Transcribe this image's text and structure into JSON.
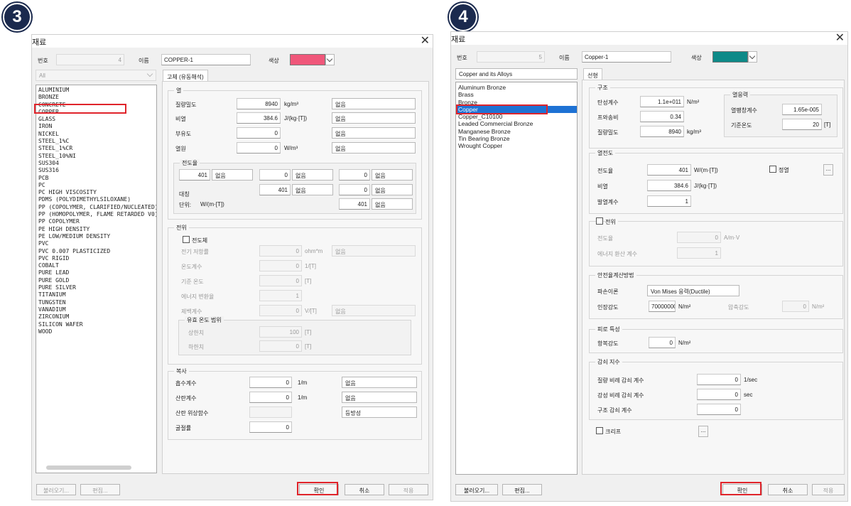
{
  "badges": {
    "left": "3",
    "right": "4"
  },
  "left": {
    "title": "재료",
    "num_label": "번호",
    "num_value": "4",
    "name_label": "이름",
    "name_value": "COPPER-1",
    "color_label": "색상",
    "color_hex": "#f0577a",
    "library": "All",
    "tab": "고체 (유동해석)",
    "materials": [
      "ALUMINIUM",
      "BRONZE",
      "CONCRETE",
      "COPPER",
      "GLASS",
      "IRON",
      "NICKEL",
      "STEEL_1%C",
      "STEEL_1%CR",
      "STEEL_10%NI",
      "SUS304",
      "SUS316",
      "PCB",
      "PC",
      "PC HIGH VISCOSITY",
      "PDMS (POLYDIMETHYLSILOXANE)",
      "PP (COPOLYMER, CLARIFIED/NUCLEATED)",
      "PP (HOMOPOLYMER, FLAME RETARDED V0)",
      "PP COPOLYMER",
      "PE HIGH DENSITY",
      "PE LOW/MEDIUM DENSITY",
      "PVC",
      "PVC 0.007 PLASTICIZED",
      "PVC RIGID",
      "COBALT",
      "PURE LEAD",
      "PURE GOLD",
      "PURE SILVER",
      "TITANIUM",
      "TUNGSTEN",
      "VANADIUM",
      "ZIRCONIUM",
      "SILICON WAFER",
      "WOOD"
    ],
    "heat": {
      "title": "열",
      "density": {
        "label": "질량밀도",
        "value": "8940",
        "unit": "kg/m³",
        "opt": "없음"
      },
      "specific_heat": {
        "label": "비열",
        "value": "384.6",
        "unit": "J/(kg·[T])",
        "opt": "없음"
      },
      "buoyancy": {
        "label": "부유도",
        "value": "0",
        "unit": "",
        "opt": "없음"
      },
      "heat_source": {
        "label": "열원",
        "value": "0",
        "unit": "W/m³",
        "opt": "없음"
      },
      "cond": {
        "title": "전도율",
        "r1": [
          {
            "v": "401",
            "o": "없음"
          },
          {
            "v": "0",
            "o": "없음"
          },
          {
            "v": "0",
            "o": "없음"
          }
        ],
        "r2": [
          {
            "v": "401",
            "o": "없음"
          },
          {
            "v": "0",
            "o": "없음"
          }
        ],
        "sym_label": "대칭",
        "unit_label": "단위:",
        "unit": "W/(m·[T])",
        "r3": {
          "v": "401",
          "o": "없음"
        }
      }
    },
    "elec": {
      "title": "전위",
      "conductor": "전도체",
      "resistivity": {
        "label": "전기 저항률",
        "value": "0",
        "unit": "ohm*m",
        "opt": "없음"
      },
      "temp_coef": {
        "label": "온도계수",
        "value": "0",
        "unit": "1/[T]"
      },
      "ref_temp": {
        "label": "기준 온도",
        "value": "0",
        "unit": "[T]"
      },
      "energy": {
        "label": "에너지 변환율",
        "value": "1"
      },
      "seebeck": {
        "label": "제백계수",
        "value": "0",
        "unit": "V/[T]",
        "opt": "없음"
      },
      "range": {
        "title": "유효 온도 범위",
        "upper_label": "상한치",
        "upper": "100",
        "lower_label": "하한치",
        "lower": "0",
        "unit": "[T]"
      }
    },
    "rad": {
      "title": "복사",
      "absorb": {
        "label": "흡수계수",
        "value": "0",
        "unit": "1/m",
        "opt": "없음"
      },
      "scatter": {
        "label": "산란계수",
        "value": "0",
        "unit": "1/m",
        "opt": "없음"
      },
      "phase": {
        "label": "산란 위상함수",
        "opt": "등방성"
      },
      "refract": {
        "label": "굴절률",
        "value": "0"
      }
    },
    "buttons": {
      "load": "불러오기...",
      "edit": "편집...",
      "ok": "확인",
      "cancel": "취소",
      "apply": "적용"
    }
  },
  "right": {
    "title": "재료",
    "num_label": "번호",
    "num_value": "5",
    "name_label": "이름",
    "name_value": "Copper-1",
    "color_label": "색상",
    "color_hex": "#0e8a88",
    "library": "Copper and its Alloys",
    "tab": "선형",
    "materials": [
      "Aluminum Bronze",
      "Brass",
      "Bronze",
      "Copper",
      "Copper_C10100",
      "Leaded Commercial Bronze",
      "Manganese Bronze",
      "Tin Bearing Bronze",
      "Wrought Copper"
    ],
    "struct": {
      "title": "구조",
      "elastic": {
        "label": "탄성계수",
        "value": "1.1e+011",
        "unit": "N/m²"
      },
      "poisson": {
        "label": "프와송비",
        "value": "0.34"
      },
      "density": {
        "label": "질량밀도",
        "value": "8940",
        "unit": "kg/m³"
      },
      "thermal": {
        "title": "열응력",
        "exp_label": "열팽창계수",
        "exp": "1.65e-005",
        "ref_label": "기준온도",
        "ref": "20",
        "ref_unit": "[T]"
      }
    },
    "heat": {
      "title": "열전도",
      "cond": {
        "label": "전도율",
        "value": "401",
        "unit": "W/(m·[T])"
      },
      "spec": {
        "label": "비열",
        "value": "384.6",
        "unit": "J/(kg·[T])"
      },
      "emis": {
        "label": "발열계수",
        "value": "1"
      },
      "dynamic": "정열",
      "more": "..."
    },
    "elec": {
      "title": "전위",
      "cond": {
        "label": "전도율",
        "value": "0",
        "unit": "A/m·V"
      },
      "energy": {
        "label": "에너지 환산 계수",
        "value": "1"
      }
    },
    "safety": {
      "title": "안전율계산방법",
      "theory_label": "파손이론",
      "theory": "Von Mises 응력(Ductile)",
      "tensile_label": "인장강도",
      "tensile": "70000000",
      "tensile_unit": "N/m²",
      "comp_label": "압축강도",
      "comp": "0",
      "comp_unit": "N/m²"
    },
    "fatigue": {
      "title": "피로 특성",
      "yield_label": "항복강도",
      "yield": "0",
      "unit": "N/m²"
    },
    "damping": {
      "title": "감쇠 지수",
      "mass": {
        "label": "질량 비례 감쇠 계수",
        "value": "0",
        "unit": "1/sec"
      },
      "stiff": {
        "label": "강성 비례 감쇠 계수",
        "value": "0",
        "unit": "sec"
      },
      "struct": {
        "label": "구조 감쇠 계수",
        "value": "0"
      }
    },
    "creep": "크리프",
    "creep_more": "...",
    "buttons": {
      "load": "불러오기...",
      "edit": "편집...",
      "ok": "확인",
      "cancel": "취소",
      "apply": "적용"
    }
  }
}
